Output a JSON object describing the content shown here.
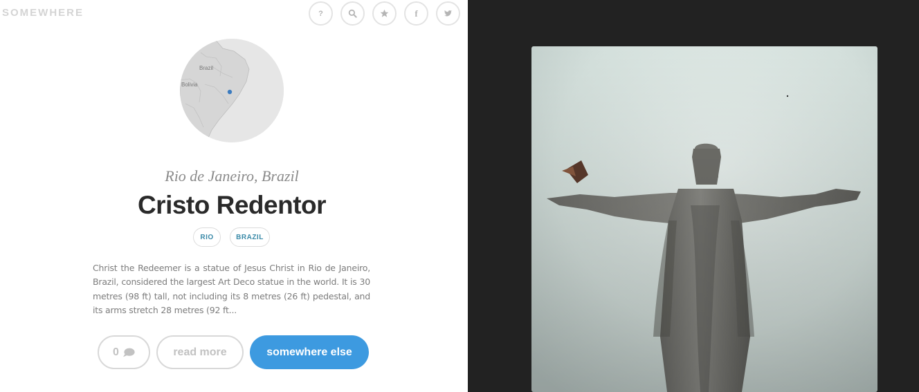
{
  "brand": {
    "logo_text": "SOMEWHERE"
  },
  "header_icons": [
    {
      "name": "help-icon",
      "glyph": "?"
    },
    {
      "name": "search-icon"
    },
    {
      "name": "star-icon"
    },
    {
      "name": "facebook-icon",
      "glyph": "f"
    },
    {
      "name": "twitter-icon"
    }
  ],
  "map": {
    "labels": {
      "country": "Brazil",
      "neighbor": "Bolivia"
    },
    "marker_color": "#3b7bbf"
  },
  "place": {
    "subtitle": "Rio de Janeiro, Brazil",
    "title": "Cristo Redentor",
    "tags": [
      "RIO",
      "BRAZIL"
    ],
    "description": "Christ the Redeemer is a statue of Jesus Christ in Rio de Janeiro, Brazil, considered the largest Art Deco statue in the world. It is 30 metres (98 ft) tall, not including its 8 metres (26 ft) pedestal, and its arms stretch 28 metres (92 ft..."
  },
  "actions": {
    "comment_count": "0",
    "read_more": "read more",
    "somewhere_else": "somewhere else"
  },
  "colors": {
    "accent": "#3d9ae0",
    "tag_text": "#3a8aa8",
    "dark_panel": "#222222"
  }
}
